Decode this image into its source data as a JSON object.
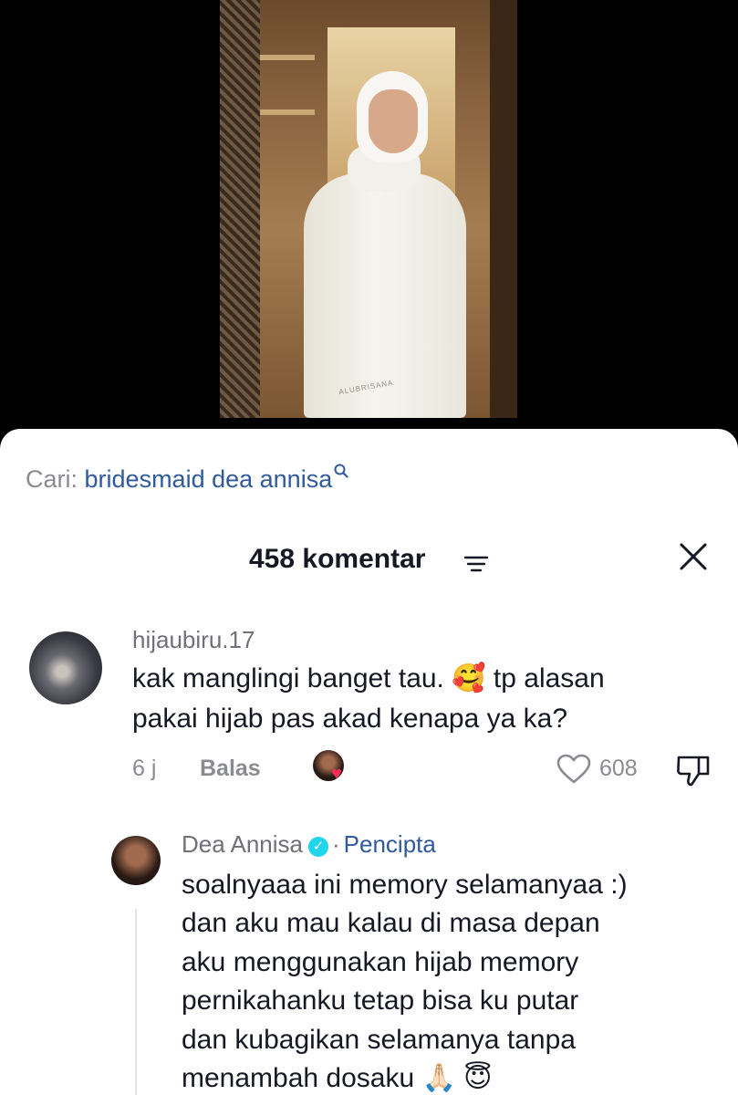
{
  "video": {
    "watermark": "ALUBRISANA"
  },
  "search": {
    "prefix": "Cari:",
    "query": "bridesmaid dea annisa"
  },
  "comments_header": {
    "count_label": "458 komentar"
  },
  "comments": [
    {
      "username": "hijaubiru.17",
      "text_line1": "kak manglingi banget tau. 🥰 tp alasan",
      "text_line2": "pakai hijab pas akad kenapa ya ka?",
      "time": "6 j",
      "reply_label": "Balas",
      "likes": "608"
    }
  ],
  "reply": {
    "username": "Dea Annisa",
    "separator": "·",
    "badge": "Pencipta",
    "lines": [
      "soalnyaaa ini memory selamanyaa :)",
      "dan aku mau kalau di masa depan",
      "aku menggunakan hijab memory",
      "pernikahanku tetap bisa ku putar",
      "dan kubagikan selamanya tanpa",
      "menambah dosaku 🙏🏻 😇"
    ]
  },
  "colors": {
    "accent_link": "#2f5a9e",
    "muted_text": "#8a8b91",
    "primary_text": "#161823",
    "verified": "#20d5ec",
    "heart": "#fe2c55"
  },
  "icons": [
    "search-icon",
    "filter-icon",
    "close-icon",
    "heart-outline-icon",
    "dislike-icon",
    "verified-icon",
    "heart-icon"
  ]
}
